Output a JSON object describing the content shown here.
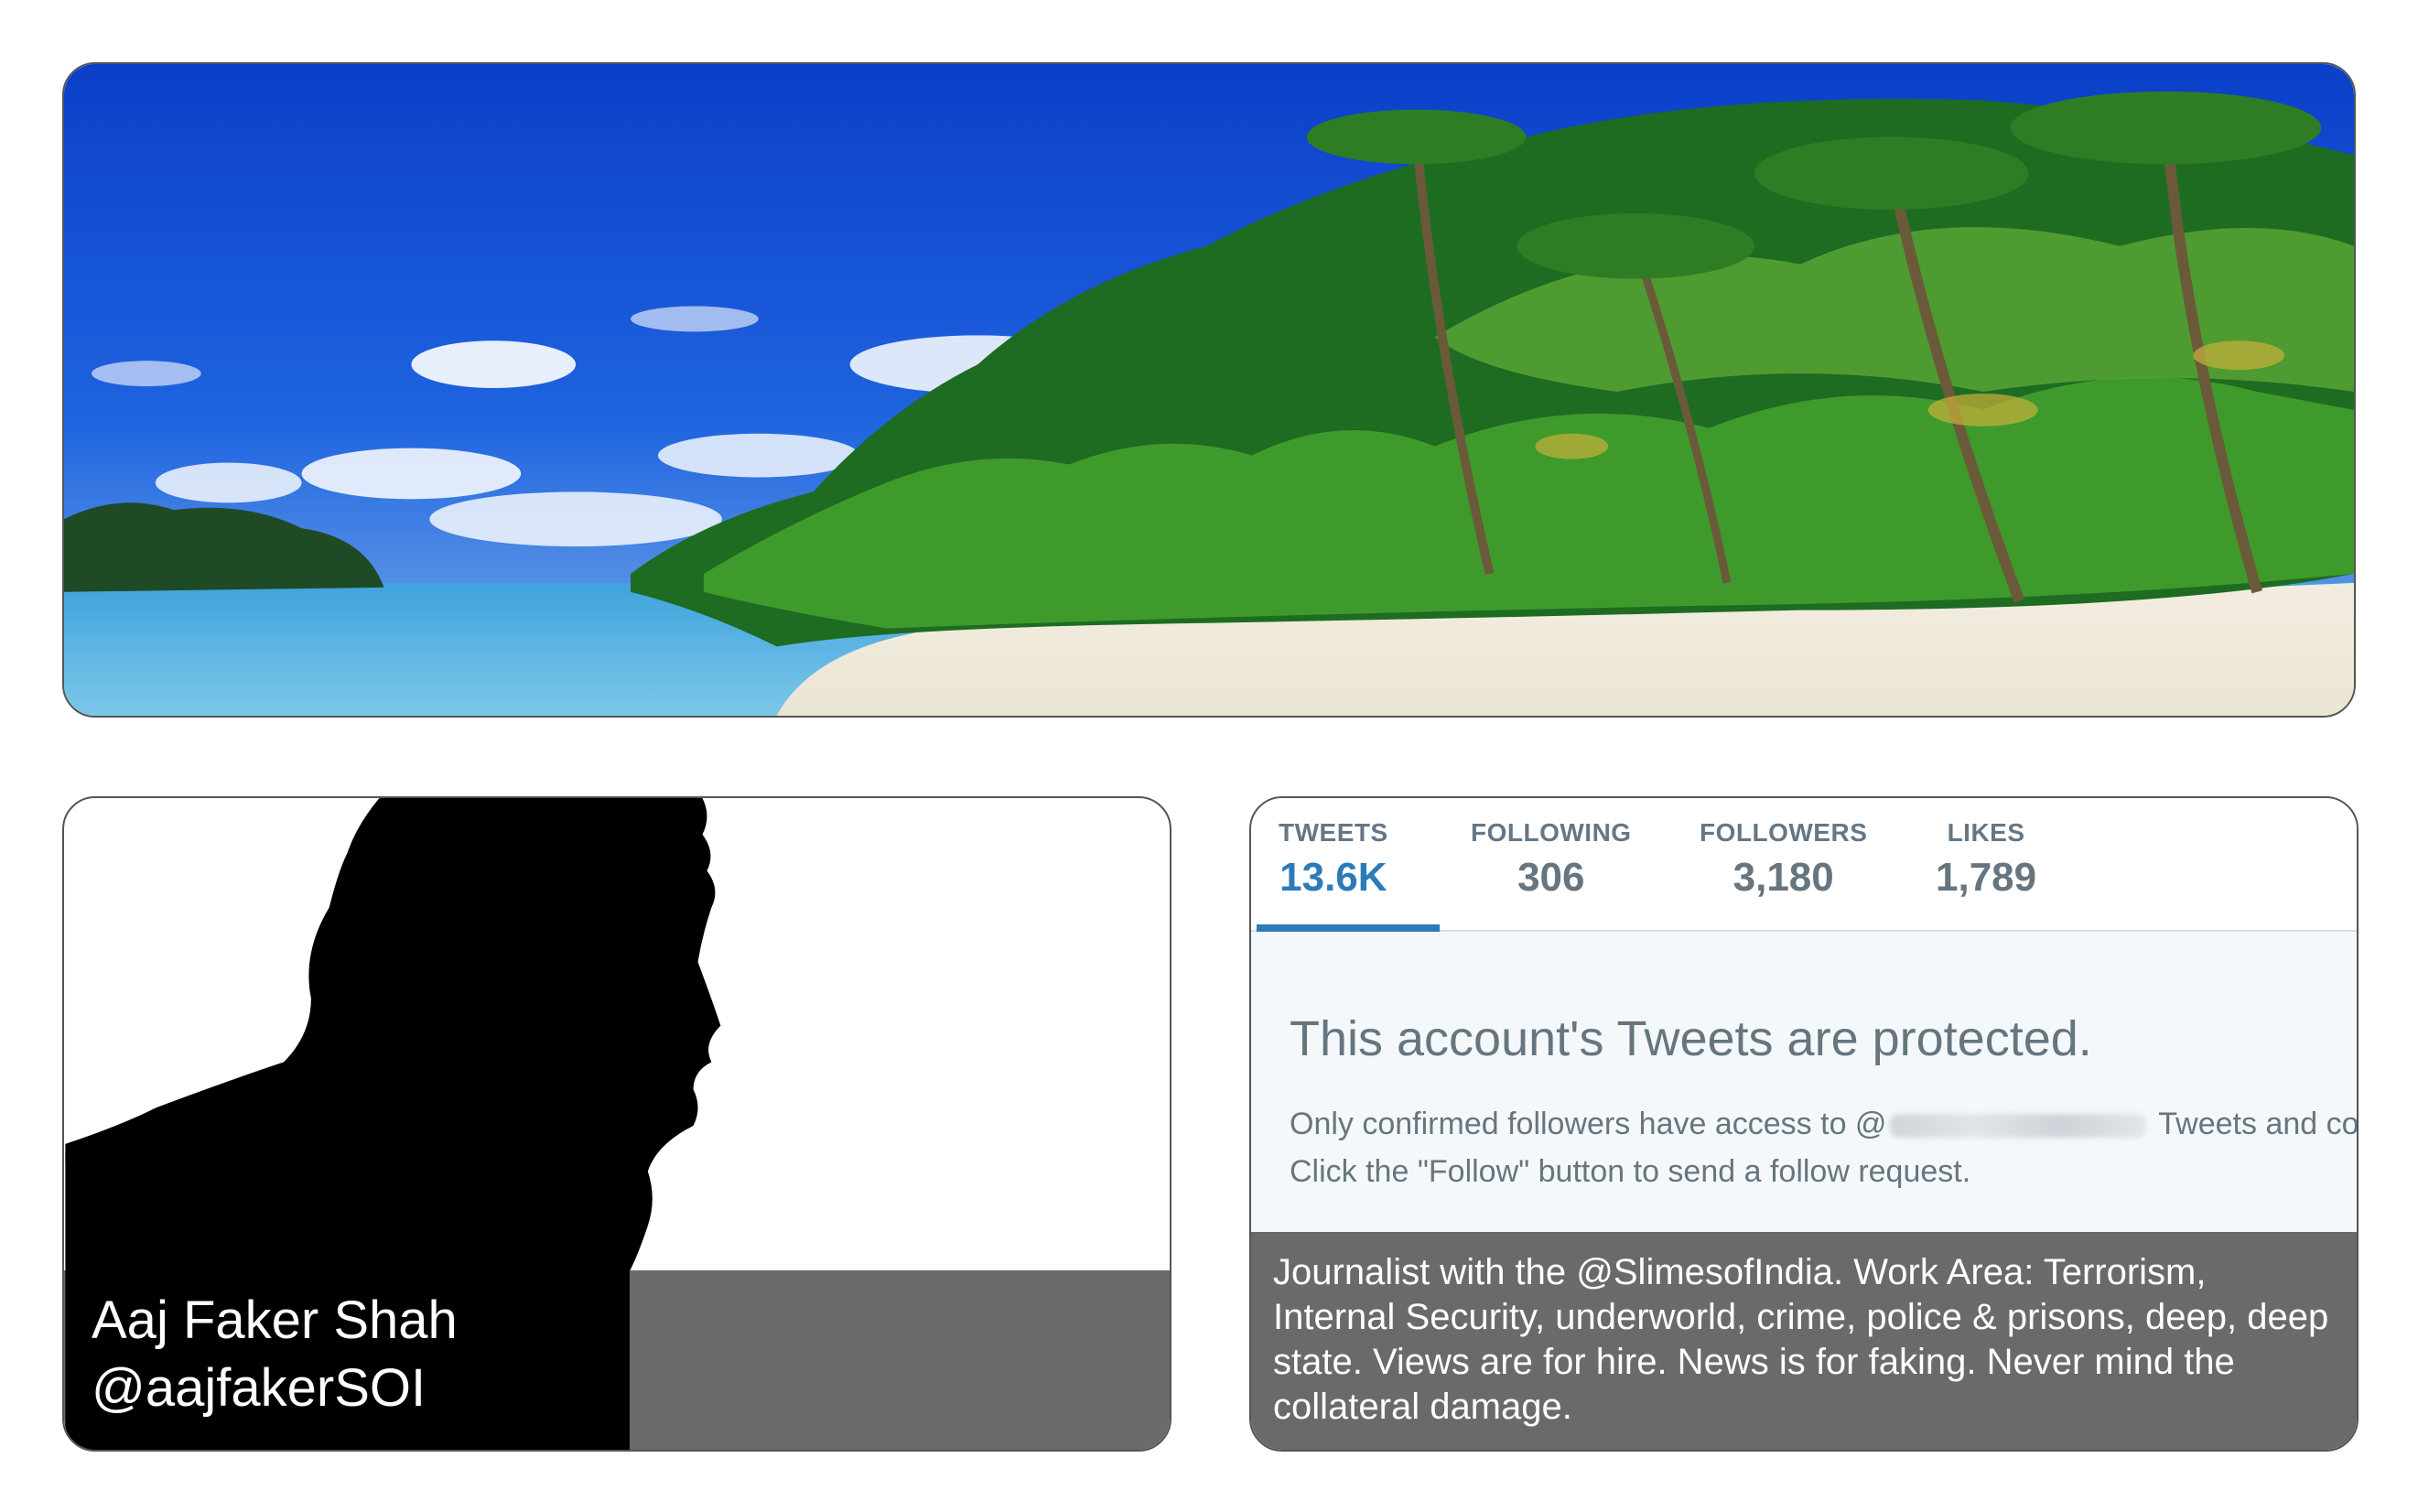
{
  "banner": {
    "description_icon": "beach-palm-image"
  },
  "profile": {
    "name": "Aaj Faker Shah",
    "handle": "@aajfakerSOI",
    "avatar_icon": "silhouette-icon"
  },
  "stats": {
    "tweets_label": "TWEETS",
    "tweets_value": "13.6K",
    "following_label": "FOLLOWING",
    "following_value": "306",
    "followers_label": "FOLLOWERS",
    "followers_value": "3,180",
    "likes_label": "LIKES",
    "likes_value": "1,789",
    "active_tab": "TWEETS"
  },
  "protected": {
    "title": "This account's Tweets are protected.",
    "line1_start": "Only confirmed followers have access to @",
    "line1_end": " Tweets and co",
    "line2": "Click the \"Follow\" button to send a follow request."
  },
  "bio": {
    "text": "Journalist with the @SlimesofIndia. Work Area: Terrorism, Internal Security, underworld, crime, police & prisons, deep, deep state. Views are for hire. News is for faking. Never mind the collateral damage."
  },
  "colors": {
    "accent": "#2b7bb9",
    "muted_text": "#66757f",
    "overlay_gray": "#6a6a6a"
  }
}
